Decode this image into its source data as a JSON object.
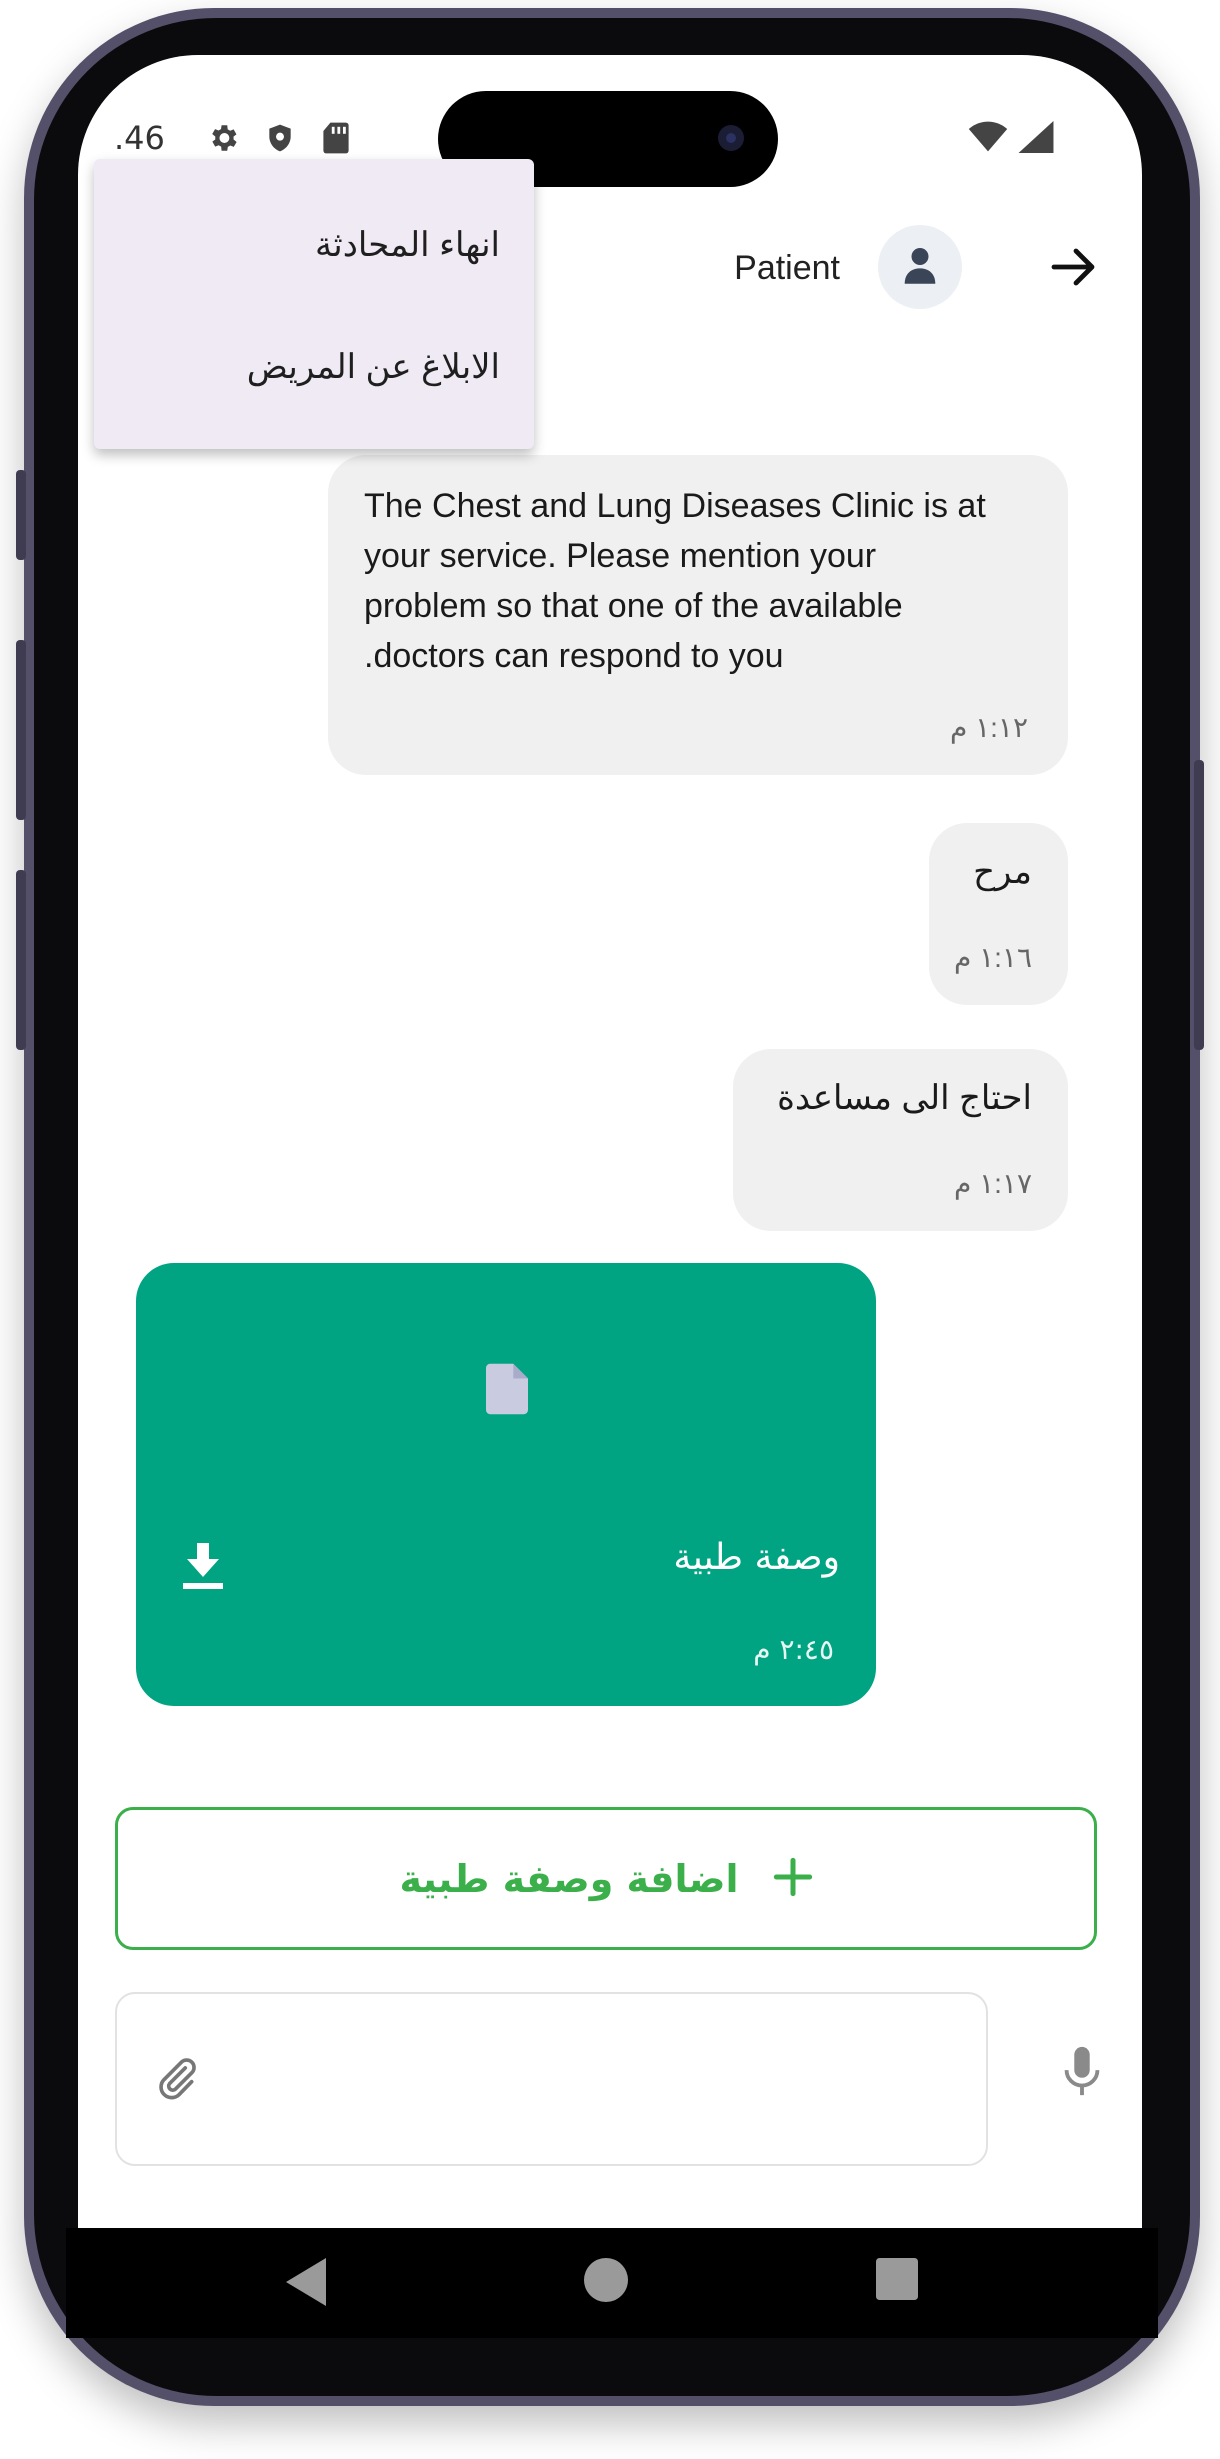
{
  "status_bar": {
    "time": ".46"
  },
  "header": {
    "patient_name": "Patient"
  },
  "menu": {
    "items": [
      {
        "label": "انهاء المحادثة"
      },
      {
        "label": "الابلاغ عن المريض"
      }
    ]
  },
  "messages": [
    {
      "text": "The Chest and Lung Diseases Clinic is at your service. Please mention your problem so that one of the available doctors can respond to you.",
      "line1": "The Chest and Lung Diseases Clinic is at",
      "line2": "your service. Please mention your",
      "line3": "problem so that one of the available",
      "line4": ".doctors can respond to you",
      "time": "١:١٢ م"
    },
    {
      "text": "مرح",
      "time": "١:١٦ م"
    },
    {
      "text": "احتاج الى مساعدة",
      "time": "١:١٧ م"
    }
  ],
  "file_message": {
    "title": "وصفة طبية",
    "time": "٢:٤٥ م"
  },
  "actions": {
    "add_prescription_label": "اضافة وصفة طبية"
  },
  "composer": {
    "placeholder": ""
  },
  "colors": {
    "file_card": "#00a482",
    "accent_green": "#3aaf4a",
    "bubble": "#f0f0f0",
    "menu": "#efeaf3"
  },
  "icons": [
    "settings-icon",
    "shield-icon",
    "sd-card-icon",
    "wifi-icon",
    "signal-icon",
    "user-icon",
    "arrow-right-icon",
    "file-icon",
    "download-icon",
    "plus-icon",
    "attach-icon",
    "mic-icon",
    "back-triangle-icon",
    "home-circle-icon",
    "recents-square-icon"
  ]
}
